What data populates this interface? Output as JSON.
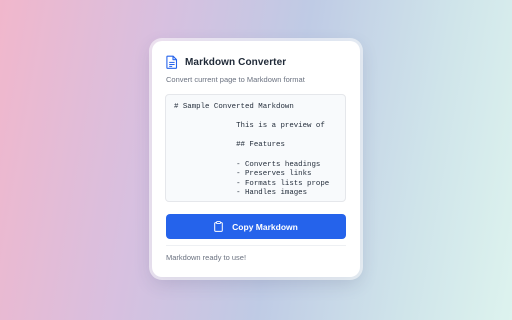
{
  "popup": {
    "title": "Markdown Converter",
    "subtitle": "Convert current page to Markdown format",
    "preview_text": "# Sample Converted Markdown\n\n              This is a preview of\n\n              ## Features\n\n              - Converts headings\n              - Preserves links\n              - Formats lists prope\n              - Handles images",
    "copy_button_label": "Copy Markdown",
    "status": "Markdown ready to use!",
    "icons": {
      "header": "document-icon",
      "button": "clipboard-icon"
    },
    "colors": {
      "accent": "#2563eb",
      "title_text": "#1f2937",
      "muted_text": "#6b7280",
      "preview_bg": "#f8fafc"
    }
  }
}
